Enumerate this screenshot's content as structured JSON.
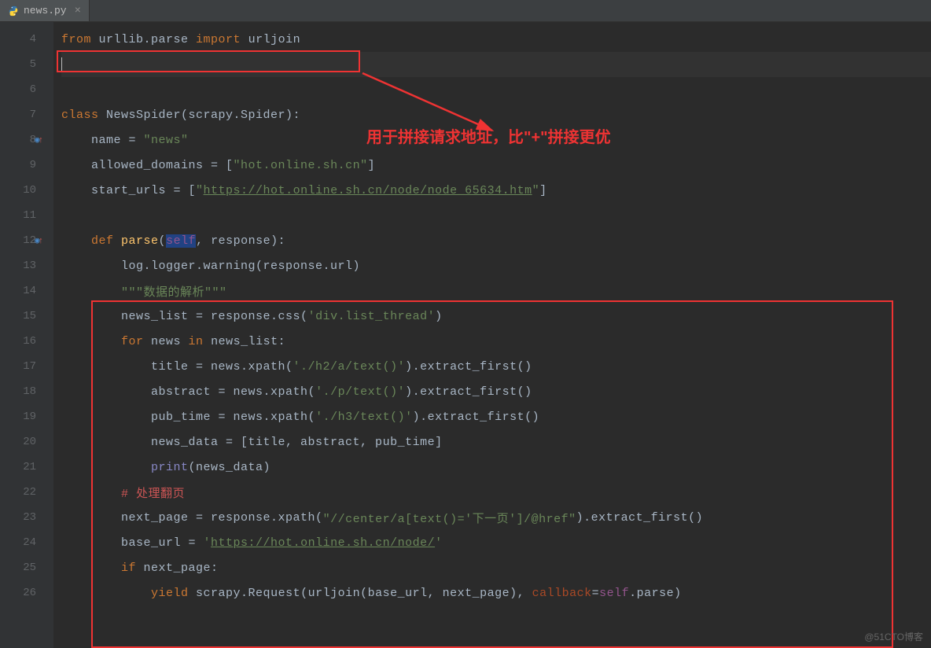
{
  "tab": {
    "filename": "news.py",
    "close_glyph": "×"
  },
  "gutter": {
    "start": 4,
    "end": 26,
    "marks": {
      "8": "override",
      "12": "override"
    }
  },
  "annotation": "用于拼接请求地址，比\"+\"拼接更优",
  "watermark": "@51CTO博客",
  "code": {
    "l4": [
      [
        "kw",
        "from"
      ],
      [
        "",
        " urllib.parse "
      ],
      [
        "kw",
        "import"
      ],
      [
        "",
        " urljoin"
      ]
    ],
    "l5": [
      [
        "caret",
        ""
      ]
    ],
    "l6": [],
    "l7": [
      [
        "kw",
        "class "
      ],
      [
        "cls",
        "NewsSpider"
      ],
      [
        "",
        "(scrapy.Spider):"
      ]
    ],
    "l8": [
      [
        "",
        "    name = "
      ],
      [
        "str",
        "\"news\""
      ]
    ],
    "l9": [
      [
        "",
        "    allowed_domains = ["
      ],
      [
        "str",
        "\"hot.online.sh.cn\""
      ],
      [
        "",
        "]"
      ]
    ],
    "l10": [
      [
        "",
        "    start_urls = ["
      ],
      [
        "str",
        "\""
      ],
      [
        "str dotted",
        "https://hot.online.sh.cn/node/node_65634.htm"
      ],
      [
        "str",
        "\""
      ],
      [
        "",
        "]"
      ]
    ],
    "l11": [],
    "l12": [
      [
        "",
        "    "
      ],
      [
        "kw",
        "def "
      ],
      [
        "fn",
        "parse"
      ],
      [
        "",
        "("
      ],
      [
        "self hl",
        "self"
      ],
      [
        "",
        ", "
      ],
      [
        "param",
        "response"
      ],
      [
        "",
        "):"
      ]
    ],
    "l13": [
      [
        "",
        "        log.logger.warning(response.url)"
      ]
    ],
    "l14": [
      [
        "",
        "        "
      ],
      [
        "str",
        "\"\"\"数据的解析\"\"\""
      ]
    ],
    "l15": [
      [
        "",
        "        news_list = response.css("
      ],
      [
        "str",
        "'div.list_thread'"
      ],
      [
        "",
        ")"
      ]
    ],
    "l16": [
      [
        "",
        "        "
      ],
      [
        "kw",
        "for"
      ],
      [
        "",
        " news "
      ],
      [
        "kw",
        "in"
      ],
      [
        "",
        " news_list:"
      ]
    ],
    "l17": [
      [
        "",
        "            title = news.xpath("
      ],
      [
        "str",
        "'./h2/a/text()'"
      ],
      [
        "",
        ").extract_first()"
      ]
    ],
    "l18": [
      [
        "",
        "            abstract = news.xpath("
      ],
      [
        "str",
        "'./p/text()'"
      ],
      [
        "",
        ").extract_first()"
      ]
    ],
    "l19": [
      [
        "",
        "            pub_time = news.xpath("
      ],
      [
        "str",
        "'./h3/text()'"
      ],
      [
        "",
        ").extract_first()"
      ]
    ],
    "l20": [
      [
        "",
        "            news_data = [title, abstract, pub_time]"
      ]
    ],
    "l21": [
      [
        "",
        "            "
      ],
      [
        "builtin",
        "print"
      ],
      [
        "",
        "(news_data)"
      ]
    ],
    "l22": [
      [
        "",
        "        "
      ],
      [
        "comment-red",
        "# 处理翻页"
      ]
    ],
    "l23": [
      [
        "",
        "        next_page = response.xpath("
      ],
      [
        "str",
        "\"//center/a[text()='下一页']/@href\""
      ],
      [
        "",
        ").extract_first()"
      ]
    ],
    "l24": [
      [
        "",
        "        base_url = "
      ],
      [
        "str",
        "'"
      ],
      [
        "str dotted",
        "https://hot.online.sh.cn/node/"
      ],
      [
        "str",
        "'"
      ]
    ],
    "l25": [
      [
        "",
        "        "
      ],
      [
        "kw",
        "if"
      ],
      [
        "",
        " next_page:"
      ]
    ],
    "l26": [
      [
        "",
        "            "
      ],
      [
        "kw",
        "yield"
      ],
      [
        "",
        " scrapy.Request(urljoin(base_url, next_page), "
      ],
      [
        "named-arg",
        "callback"
      ],
      [
        "",
        "="
      ],
      [
        "self",
        "self"
      ],
      [
        "",
        ".parse)"
      ]
    ]
  }
}
